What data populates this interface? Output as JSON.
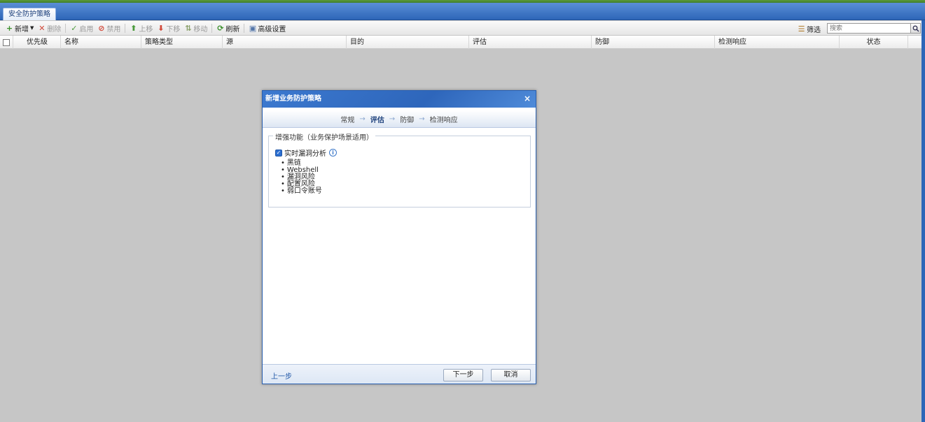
{
  "tab": {
    "label": "安全防护策略"
  },
  "toolbar": {
    "add": "新增",
    "delete": "删除",
    "enable": "启用",
    "disable": "禁用",
    "move_up": "上移",
    "move_down": "下移",
    "move": "移动",
    "refresh": "刷新",
    "advanced": "高级设置",
    "filter": "筛选",
    "search_placeholder": "搜索"
  },
  "grid": {
    "columns": [
      "优先级",
      "名称",
      "策略类型",
      "源",
      "目的",
      "评估",
      "防御",
      "检测响应",
      "状态"
    ]
  },
  "dialog": {
    "title": "新增业务防护策略",
    "close_symbol": "×",
    "steps": [
      "常规",
      "评估",
      "防御",
      "检测响应"
    ],
    "active_step": "评估",
    "fieldset_legend": "增强功能（业务保护场景适用）",
    "realtime_check_label": "实时漏洞分析",
    "realtime_checked": true,
    "items": [
      "黑链",
      "Webshell",
      "漏洞风险",
      "配置风险",
      "弱口令账号"
    ],
    "prev_label": "上一步",
    "next_label": "下一步",
    "cancel_label": "取消"
  },
  "icons": {
    "add": "plus-icon",
    "delete": "x-icon",
    "enable": "check-icon",
    "disable": "ban-icon",
    "move_up": "arrow-up-icon",
    "move_down": "arrow-down-icon",
    "move": "move-icon",
    "refresh": "refresh-icon",
    "advanced": "settings-icon",
    "filter": "filter-icon",
    "search": "magnifier-icon",
    "info": "info-icon"
  },
  "colors": {
    "accent_blue": "#2d66b8",
    "add_green": "#3a8f2a",
    "delete_red": "#d24a3a",
    "background_gray": "#c6c6c6"
  }
}
